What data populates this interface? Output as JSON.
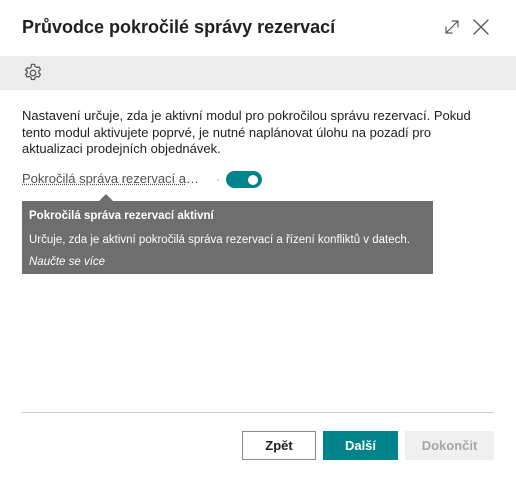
{
  "window": {
    "title": "Průvodce pokročilé správy rezervací",
    "expand_icon": "expand-icon",
    "close_icon": "close-icon"
  },
  "actionbar": {
    "settings_icon": "gear-icon"
  },
  "content": {
    "description": "Nastavení určuje, zda je aktivní modul pro pokročilou správu rezervací. Pokud tento modul aktivujete poprvé, je nutné naplánovat úlohu na pozadí pro aktualizaci prodejních objednávek.",
    "field": {
      "label": "Pokročilá správa rezervací aktivní",
      "toggle_on": true,
      "accent_color": "#00838a"
    },
    "tooltip": {
      "title": "Pokročilá správa rezervací aktivní",
      "text": "Určuje, zda je aktivní pokročilá správa rezervací a řízení konfliktů v datech.",
      "link": "Naučte se více"
    }
  },
  "footer": {
    "back_label": "Zpět",
    "next_label": "Další",
    "finish_label": "Dokončit"
  }
}
